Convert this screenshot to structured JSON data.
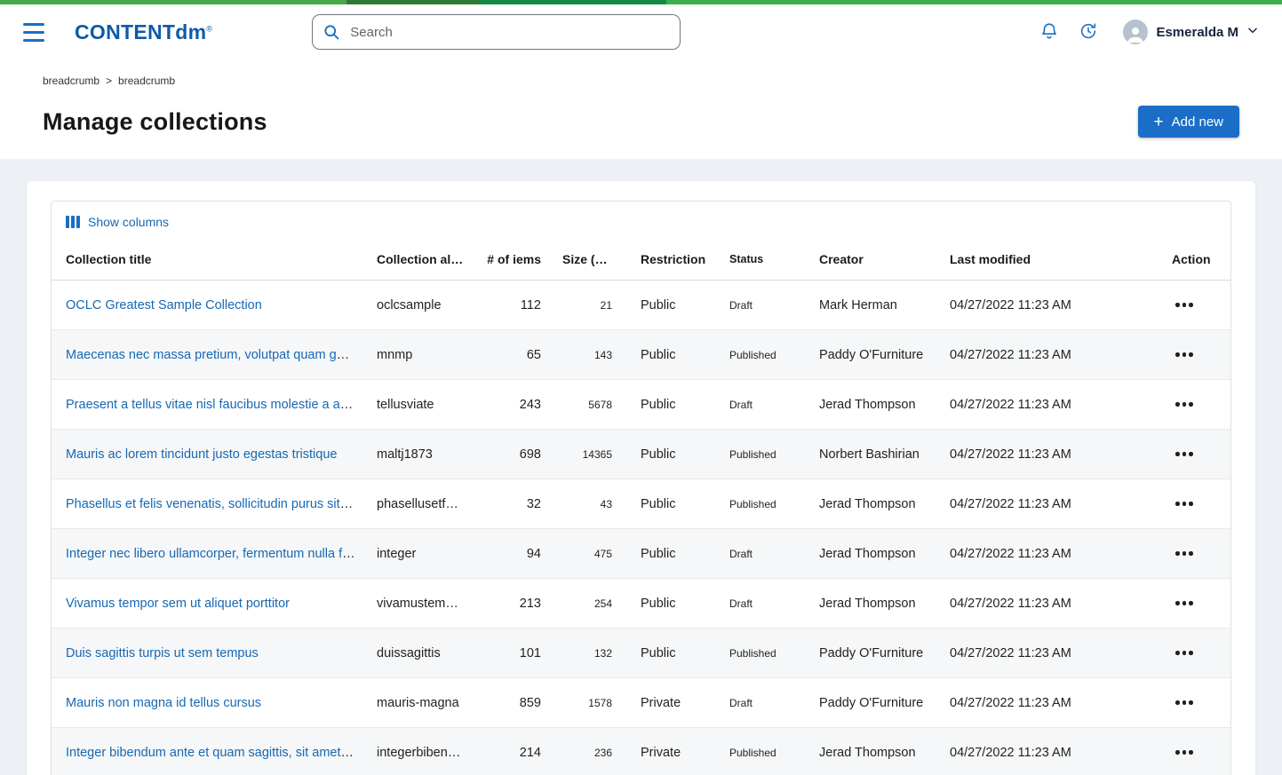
{
  "colors": {
    "brand_strip": [
      "#48a948",
      "#2f7a33",
      "#128a45",
      "#3cae4c"
    ],
    "accent_blue": "#1a6fc4",
    "button_blue": "#1b6ec7",
    "link_blue": "#1668b3",
    "logo_blue": "#0d5ba8",
    "content_background": "#edf1f5"
  },
  "topbar": {
    "logo": "CONTENTdm",
    "logo_mark": "®",
    "search_placeholder": "Search",
    "user_name": "Esmeralda M"
  },
  "breadcrumb": {
    "items": [
      "breadcrumb",
      "breadcrumb"
    ],
    "separator": ">"
  },
  "page": {
    "title": "Manage collections",
    "add_new_label": "Add new",
    "plus_icon": "+"
  },
  "table": {
    "show_columns_label": "Show columns",
    "columns": [
      "Collection title",
      "Collection alias",
      "# of iems",
      "Size (MB)",
      "Restriction",
      "Status",
      "Creator",
      "Last modified",
      "Action"
    ],
    "rows": [
      {
        "title": "OCLC Greatest Sample Collection",
        "alias": "oclcsample",
        "items": "112",
        "size": "21",
        "restriction": "Public",
        "status": "Draft",
        "creator": "Mark Herman",
        "modified": "04/27/2022 11:23 AM"
      },
      {
        "title": "Maecenas nec massa pretium, volutpat quam gubn ...",
        "alias": "mnmp",
        "items": "65",
        "size": "143",
        "restriction": "Public",
        "status": "Published",
        "creator": "Paddy O'Furniture",
        "modified": "04/27/2022 11:23 AM"
      },
      {
        "title": "Praesent a tellus vitae nisl faucibus molestie a abr ...",
        "alias": "tellusviate",
        "items": "243",
        "size": "5678",
        "restriction": "Public",
        "status": "Draft",
        "creator": "Jerad Thompson",
        "modified": "04/27/2022 11:23 AM"
      },
      {
        "title": "Mauris ac lorem tincidunt justo egestas tristique",
        "alias": "maltj1873",
        "items": "698",
        "size": "14365",
        "restriction": "Public",
        "status": "Published",
        "creator": "Norbert Bashirian",
        "modified": "04/27/2022 11:23 AM"
      },
      {
        "title": "Phasellus et felis venenatis, sollicitudin purus sit a...",
        "alias": "phasellusetfelis",
        "items": "32",
        "size": "43",
        "restriction": "Public",
        "status": "Published",
        "creator": "Jerad Thompson",
        "modified": "04/27/2022 11:23 AM"
      },
      {
        "title": "Integer nec libero ullamcorper, fermentum nulla fei...",
        "alias": "integer",
        "items": "94",
        "size": "475",
        "restriction": "Public",
        "status": "Draft",
        "creator": "Jerad Thompson",
        "modified": "04/27/2022 11:23 AM"
      },
      {
        "title": "Vivamus tempor sem ut aliquet porttitor",
        "alias": "vivamustempor",
        "items": "213",
        "size": "254",
        "restriction": "Public",
        "status": "Draft",
        "creator": "Jerad Thompson",
        "modified": "04/27/2022 11:23 AM"
      },
      {
        "title": "Duis sagittis turpis ut sem tempus",
        "alias": "duissagittis",
        "items": "101",
        "size": "132",
        "restriction": "Public",
        "status": "Published",
        "creator": "Paddy O'Furniture",
        "modified": "04/27/2022 11:23 AM"
      },
      {
        "title": "Mauris non magna id tellus cursus",
        "alias": "mauris-magna",
        "items": "859",
        "size": "1578",
        "restriction": "Private",
        "status": "Draft",
        "creator": "Paddy O'Furniture",
        "modified": "04/27/2022 11:23 AM"
      },
      {
        "title": "Integer bibendum ante et quam sagittis, sit amet lac...",
        "alias": "integerbibendum",
        "items": "214",
        "size": "236",
        "restriction": "Private",
        "status": "Published",
        "creator": "Jerad Thompson",
        "modified": "04/27/2022 11:23 AM"
      }
    ]
  }
}
